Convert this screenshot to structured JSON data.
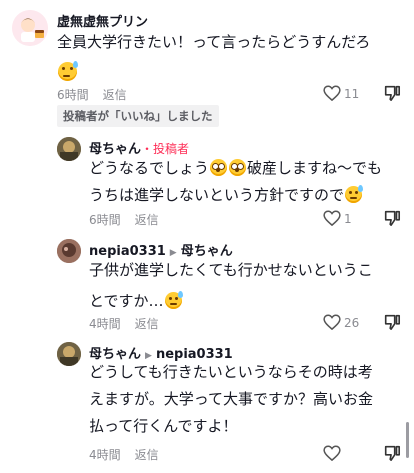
{
  "comment1": {
    "username": "虚無虚無プリン",
    "text_line1": "全員大学行きたい！って言ったらどうすんだろ",
    "time": "6時間",
    "reply_label": "返信",
    "likes": "11",
    "creator_liked": "投稿者が「いいね」しました"
  },
  "reply1": {
    "username": "母ちゃん",
    "author_tag": "・投稿者",
    "text_line1": "どうなるでしょう",
    "text_line1b": "破産しますね〜でも",
    "text_line2": "うちは進学しないという方針ですので",
    "time": "6時間",
    "reply_label": "返信",
    "likes": "1"
  },
  "reply2": {
    "username": "nepia0331",
    "reply_to": "母ちゃん",
    "text_line1": "子供が進学したくても行かせないというこ",
    "text_line2": "とですか…",
    "time": "4時間",
    "reply_label": "返信",
    "likes": "26"
  },
  "reply3": {
    "username": "母ちゃん",
    "reply_to": "nepia0331",
    "text_line1": "どうしても行きたいというならその時は考",
    "text_line2": "えますが。大学って大事ですか？高いお金",
    "text_line3": "払って行くんですよ！",
    "time": "4時間",
    "reply_label": "返信"
  },
  "colors": {
    "accent": "#fe2c55",
    "muted": "#8a8b91",
    "text": "#161823"
  }
}
